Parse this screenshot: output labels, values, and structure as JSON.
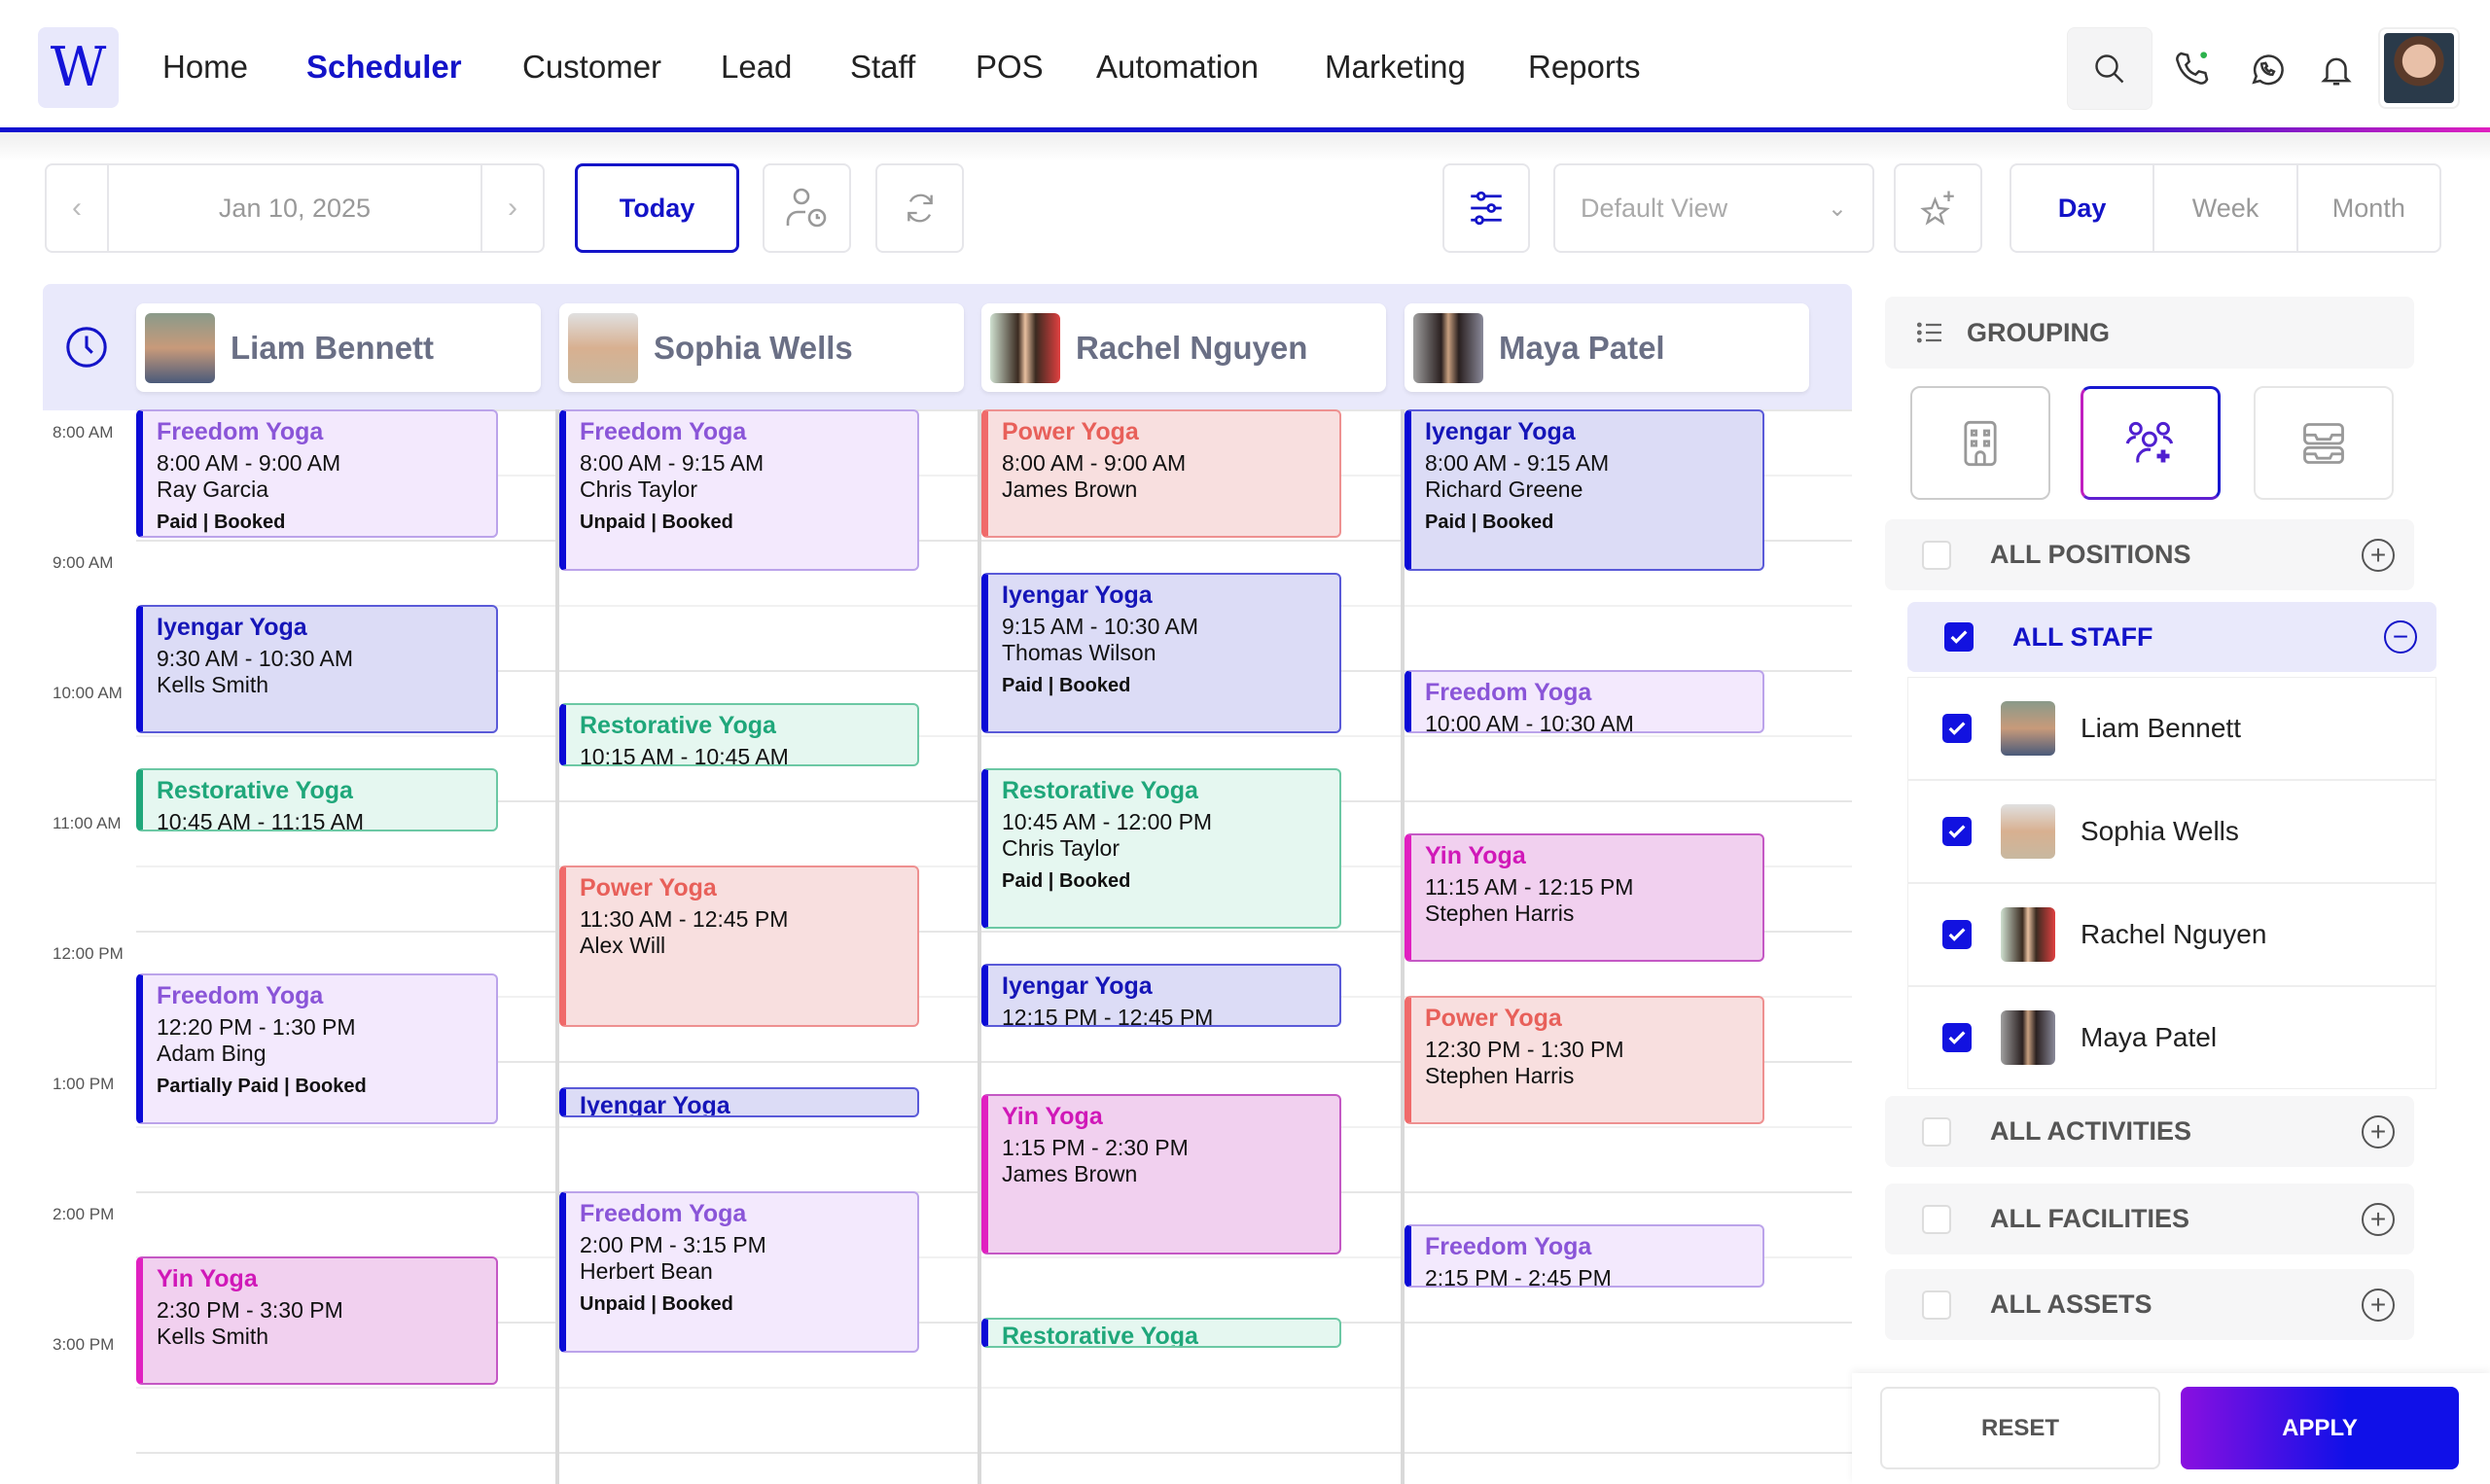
{
  "header": {
    "logo": "W",
    "nav": [
      "Home",
      "Scheduler",
      "Customer",
      "Lead",
      "Staff",
      "POS",
      "Automation",
      "Marketing",
      "Reports"
    ],
    "active_nav": "Scheduler"
  },
  "toolbar": {
    "date": "Jan 10, 2025",
    "today": "Today",
    "view_select": "Default View",
    "views": [
      "Day",
      "Week",
      "Month"
    ],
    "active_view": "Day"
  },
  "staff": [
    "Liam Bennett",
    "Sophia Wells",
    "Rachel Nguyen",
    "Maya Patel"
  ],
  "time_labels": [
    "8:00 AM",
    "9:00 AM",
    "10:00 AM",
    "11:00 AM",
    "12:00 PM",
    "1:00 PM",
    "2:00 PM",
    "3:00 PM"
  ],
  "colors": {
    "accent": "#1313c8",
    "freedom": "#8a55d8",
    "iyengar": "#1515b8",
    "restorative": "#1fa77a",
    "power": "#e8605a",
    "yin": "#d018b8"
  },
  "events": [
    {
      "staff": 0,
      "type": "freedom",
      "title": "Freedom Yoga",
      "time": "8:00 AM - 9:00 AM",
      "start": 8,
      "end": 9,
      "client": "Ray Garcia",
      "status": "Paid | Booked"
    },
    {
      "staff": 0,
      "type": "iyengar",
      "title": "Iyengar Yoga",
      "time": "9:30 AM - 10:30 AM",
      "start": 9.5,
      "end": 10.5,
      "client": "Kells Smith"
    },
    {
      "staff": 0,
      "type": "restorative",
      "title": "Restorative Yoga",
      "time": "10:45 AM - 11:15 AM",
      "start": 10.75,
      "end": 11.25
    },
    {
      "staff": 0,
      "type": "freedom",
      "title": "Freedom Yoga",
      "time": "12:20 PM - 1:30 PM",
      "start": 12.33,
      "end": 13.5,
      "client": "Adam Bing",
      "status": "Partially Paid | Booked"
    },
    {
      "staff": 0,
      "type": "yin",
      "title": "Yin Yoga",
      "time": "2:30 PM - 3:30 PM",
      "start": 14.5,
      "end": 15.5,
      "client": "Kells Smith"
    },
    {
      "staff": 1,
      "type": "freedom",
      "title": "Freedom Yoga",
      "time": "8:00 AM - 9:15 AM",
      "start": 8,
      "end": 9.25,
      "client": "Chris Taylor",
      "status": "Unpaid | Booked"
    },
    {
      "staff": 1,
      "type": "restorative",
      "title": "Restorative Yoga",
      "time": "10:15 AM - 10:45 AM",
      "start": 10.25,
      "end": 10.75
    },
    {
      "staff": 1,
      "type": "power",
      "title": "Power Yoga",
      "time": "11:30 AM - 12:45 PM",
      "start": 11.5,
      "end": 12.75,
      "client": "Alex Will"
    },
    {
      "staff": 1,
      "type": "iyengar",
      "title": "Iyengar Yoga",
      "start": 13.2,
      "end": 13.45
    },
    {
      "staff": 1,
      "type": "freedom",
      "title": "Freedom Yoga",
      "time": "2:00 PM - 3:15 PM",
      "start": 14,
      "end": 15.25,
      "client": "Herbert Bean",
      "status": "Unpaid | Booked"
    },
    {
      "staff": 2,
      "type": "power",
      "title": "Power Yoga",
      "time": "8:00 AM - 9:00 AM",
      "start": 8,
      "end": 9,
      "client": "James Brown"
    },
    {
      "staff": 2,
      "type": "iyengar",
      "title": "Iyengar Yoga",
      "time": "9:15 AM - 10:30 AM",
      "start": 9.25,
      "end": 10.5,
      "client": "Thomas Wilson",
      "status": "Paid | Booked"
    },
    {
      "staff": 2,
      "type": "restorative",
      "title": "Restorative Yoga",
      "time": "10:45 AM - 12:00 PM",
      "start": 10.75,
      "end": 12,
      "client": "Chris Taylor",
      "status": "Paid | Booked"
    },
    {
      "staff": 2,
      "type": "iyengar",
      "title": "Iyengar Yoga",
      "time": "12:15 PM - 12:45 PM",
      "start": 12.25,
      "end": 12.75
    },
    {
      "staff": 2,
      "type": "yin",
      "title": "Yin Yoga",
      "time": "1:15 PM - 2:30 PM",
      "start": 13.25,
      "end": 14.5,
      "client": "James Brown"
    },
    {
      "staff": 2,
      "type": "restorative",
      "title": "Restorative Yoga",
      "start": 14.97,
      "end": 15.22
    },
    {
      "staff": 3,
      "type": "iyengar",
      "title": "Iyengar Yoga",
      "time": "8:00 AM - 9:15 AM",
      "start": 8,
      "end": 9.25,
      "client": "Richard Greene",
      "status": "Paid | Booked"
    },
    {
      "staff": 3,
      "type": "freedom",
      "title": "Freedom Yoga",
      "time": "10:00 AM - 10:30 AM",
      "start": 10,
      "end": 10.5
    },
    {
      "staff": 3,
      "type": "yin",
      "title": "Yin Yoga",
      "time": "11:15 AM - 12:15 PM",
      "start": 11.25,
      "end": 12.25,
      "client": "Stephen Harris"
    },
    {
      "staff": 3,
      "type": "power",
      "title": "Power Yoga",
      "time": "12:30 PM - 1:30 PM",
      "start": 12.5,
      "end": 13.5,
      "client": "Stephen Harris"
    },
    {
      "staff": 3,
      "type": "freedom",
      "title": "Freedom Yoga",
      "time": "2:15 PM - 2:45 PM",
      "start": 14.25,
      "end": 14.75
    }
  ],
  "panel": {
    "grouping": "GROUPING",
    "all_positions": "ALL POSITIONS",
    "all_staff": "ALL STAFF",
    "all_activities": "ALL ACTIVITIES",
    "all_facilities": "ALL FACILITIES",
    "all_assets": "ALL ASSETS",
    "reset": "RESET",
    "apply": "APPLY"
  }
}
